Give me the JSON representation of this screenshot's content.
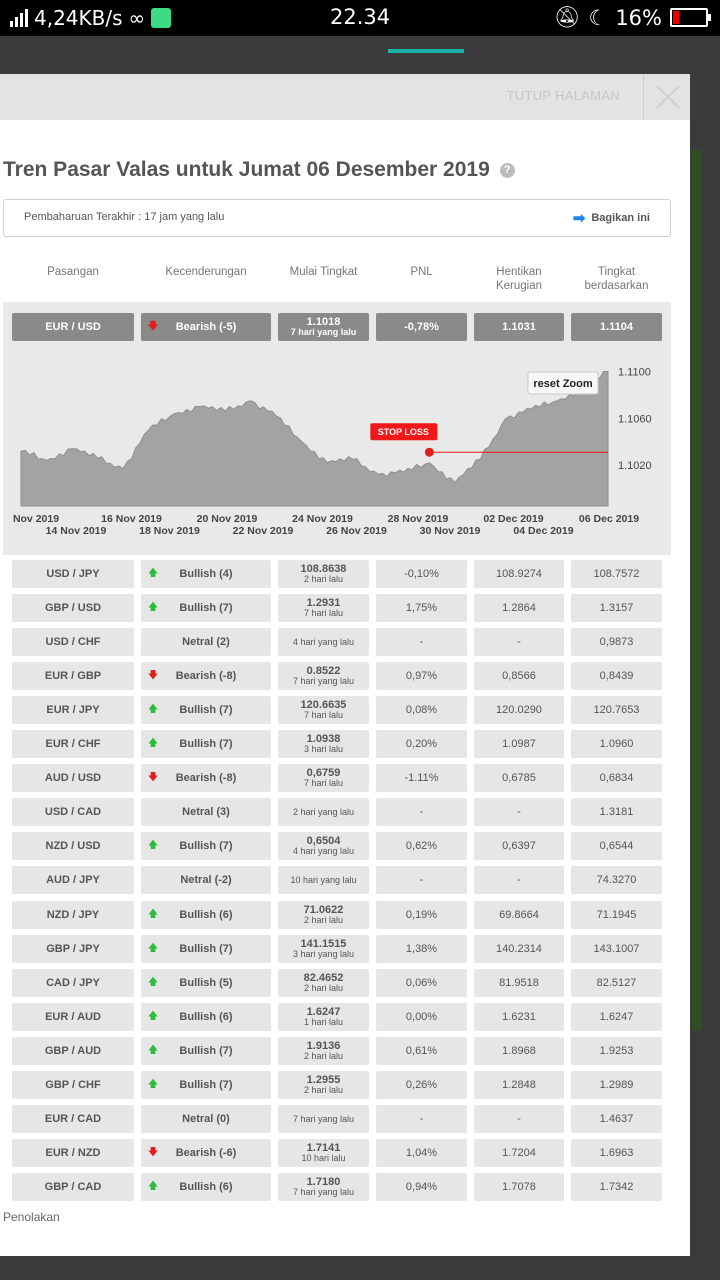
{
  "status_bar": {
    "speed": "4,24KB/s",
    "infinity": "∞",
    "time": "22.34",
    "battery": "16%"
  },
  "modal": {
    "close_label": "TUTUP HALAMAN",
    "title": "Tren Pasar Valas untuk Jumat 06 Desember 2019",
    "help": "?",
    "update": "Pembaharuan Terakhir : 17 jam yang lalu",
    "share": "Bagikan ini",
    "headers": [
      "Pasangan",
      "Kecenderungan",
      "Mulai Tingkat",
      "PNL",
      "Hentikan Kerugian",
      "Tingkat berdasarkan"
    ],
    "footer": "Penolakan"
  },
  "featured": {
    "pair": "EUR / USD",
    "trend": "Bearish (-5)",
    "dir": "down",
    "start": "1.1018",
    "ago": "7 hari yang lalu",
    "pnl": "-0,78%",
    "stop": "1.1031",
    "rate": "1.1104"
  },
  "chart_data": {
    "type": "area",
    "title": "",
    "reset_label": "reset Zoom",
    "stop_loss_label": "STOP LOSS",
    "stop_loss": 1.1031,
    "entry": {
      "x": "2019-11-29",
      "y": 1.1031
    },
    "ylim": [
      1.0985,
      1.1115
    ],
    "y_ticks": [
      "1.1100",
      "1.1060",
      "1.1020"
    ],
    "x_ticks_top": [
      "Nov 2019",
      "16 Nov 2019",
      "20 Nov 2019",
      "24 Nov 2019",
      "28 Nov 2019",
      "02 Dec 2019",
      "06 Dec 2019"
    ],
    "x_ticks_bottom": [
      "14 Nov 2019",
      "18 Nov 2019",
      "22 Nov 2019",
      "26 Nov 2019",
      "30 Nov 2019",
      "04 Dec 2019"
    ],
    "x_start": "2019-11-13",
    "x_end": "2019-12-06",
    "series": [
      {
        "values": [
          [
            "2019-11-13",
            1.1032
          ],
          [
            "2019-11-14",
            1.1024
          ],
          [
            "2019-11-15",
            1.1034
          ],
          [
            "2019-11-16",
            1.1026
          ],
          [
            "2019-11-17",
            1.1017
          ],
          [
            "2019-11-18",
            1.105
          ],
          [
            "2019-11-19",
            1.1064
          ],
          [
            "2019-11-20",
            1.107
          ],
          [
            "2019-11-21",
            1.1066
          ],
          [
            "2019-11-22",
            1.1075
          ],
          [
            "2019-11-23",
            1.1062
          ],
          [
            "2019-11-24",
            1.104
          ],
          [
            "2019-11-25",
            1.1022
          ],
          [
            "2019-11-26",
            1.1025
          ],
          [
            "2019-11-27",
            1.1012
          ],
          [
            "2019-11-28",
            1.1014
          ],
          [
            "2019-11-29",
            1.1022
          ],
          [
            "2019-11-30",
            1.1005
          ],
          [
            "2019-12-01",
            1.1025
          ],
          [
            "2019-12-02",
            1.106
          ],
          [
            "2019-12-03",
            1.1068
          ],
          [
            "2019-12-04",
            1.1075
          ],
          [
            "2019-12-05",
            1.1085
          ],
          [
            "2019-12-06",
            1.11
          ]
        ]
      }
    ]
  },
  "rows": [
    {
      "pair": "USD / JPY",
      "dir": "up",
      "trend": "Bullish (4)",
      "start": "108.8638",
      "ago": "2 hari lalu",
      "pnl": "-0,10%",
      "stop": "108.9274",
      "rate": "108.7572"
    },
    {
      "pair": "GBP / USD",
      "dir": "up",
      "trend": "Bullish (7)",
      "start": "1.2931",
      "ago": "7 hari lalu",
      "pnl": "1,75%",
      "stop": "1.2864",
      "rate": "1.3157"
    },
    {
      "pair": "USD / CHF",
      "dir": "none",
      "trend": "Netral (2)",
      "start": "",
      "ago": "4 hari yang lalu",
      "pnl": "-",
      "stop": "-",
      "rate": "0,9873"
    },
    {
      "pair": "EUR / GBP",
      "dir": "down",
      "trend": "Bearish (-8)",
      "start": "0.8522",
      "ago": "7 hari yang lalu",
      "pnl": "0,97%",
      "stop": "0,8566",
      "rate": "0,8439"
    },
    {
      "pair": "EUR / JPY",
      "dir": "up",
      "trend": "Bullish (7)",
      "start": "120.6635",
      "ago": "7 hari lalu",
      "pnl": "0,08%",
      "stop": "120.0290",
      "rate": "120.7653"
    },
    {
      "pair": "EUR / CHF",
      "dir": "up",
      "trend": "Bullish (7)",
      "start": "1.0938",
      "ago": "3 hari lalu",
      "pnl": "0,20%",
      "stop": "1.0987",
      "rate": "1.0960"
    },
    {
      "pair": "AUD / USD",
      "dir": "down",
      "trend": "Bearish (-8)",
      "start": "0,6759",
      "ago": "7 hari lalu",
      "pnl": "-1.11%",
      "stop": "0,6785",
      "rate": "0,6834"
    },
    {
      "pair": "USD / CAD",
      "dir": "none",
      "trend": "Netral (3)",
      "start": "",
      "ago": "2 hari yang lalu",
      "pnl": "-",
      "stop": "-",
      "rate": "1.3181"
    },
    {
      "pair": "NZD / USD",
      "dir": "up",
      "trend": "Bullish (7)",
      "start": "0,6504",
      "ago": "4 hari yang lalu",
      "pnl": "0,62%",
      "stop": "0,6397",
      "rate": "0,6544"
    },
    {
      "pair": "AUD / JPY",
      "dir": "none",
      "trend": "Netral (-2)",
      "start": "",
      "ago": "10 hari yang lalu",
      "pnl": "-",
      "stop": "-",
      "rate": "74.3270"
    },
    {
      "pair": "NZD / JPY",
      "dir": "up",
      "trend": "Bullish (6)",
      "start": "71.0622",
      "ago": "2 hari lalu",
      "pnl": "0,19%",
      "stop": "69.8664",
      "rate": "71.1945"
    },
    {
      "pair": "GBP / JPY",
      "dir": "up",
      "trend": "Bullish (7)",
      "start": "141.1515",
      "ago": "3 hari yang lalu",
      "pnl": "1,38%",
      "stop": "140.2314",
      "rate": "143.1007"
    },
    {
      "pair": "CAD / JPY",
      "dir": "up",
      "trend": "Bullish (5)",
      "start": "82.4652",
      "ago": "2 hari lalu",
      "pnl": "0,06%",
      "stop": "81.9518",
      "rate": "82.5127"
    },
    {
      "pair": "EUR / AUD",
      "dir": "up",
      "trend": "Bullish (6)",
      "start": "1.6247",
      "ago": "1 hari lalu",
      "pnl": "0,00%",
      "stop": "1.6231",
      "rate": "1.6247"
    },
    {
      "pair": "GBP / AUD",
      "dir": "up",
      "trend": "Bullish (7)",
      "start": "1.9136",
      "ago": "2 hari lalu",
      "pnl": "0,61%",
      "stop": "1.8968",
      "rate": "1.9253"
    },
    {
      "pair": "GBP / CHF",
      "dir": "up",
      "trend": "Bullish (7)",
      "start": "1.2955",
      "ago": "2 hari lalu",
      "pnl": "0,26%",
      "stop": "1.2848",
      "rate": "1.2989"
    },
    {
      "pair": "EUR / CAD",
      "dir": "none",
      "trend": "Netral (0)",
      "start": "",
      "ago": "7 hari yang lalu",
      "pnl": "-",
      "stop": "-",
      "rate": "1.4637"
    },
    {
      "pair": "EUR / NZD",
      "dir": "down",
      "trend": "Bearish (-6)",
      "start": "1.7141",
      "ago": "10 hari lalu",
      "pnl": "1,04%",
      "stop": "1.7204",
      "rate": "1.6963"
    },
    {
      "pair": "GBP / CAD",
      "dir": "up",
      "trend": "Bullish (6)",
      "start": "1.7180",
      "ago": "7 hari yang lalu",
      "pnl": "0,94%",
      "stop": "1.7078",
      "rate": "1.7342"
    }
  ]
}
